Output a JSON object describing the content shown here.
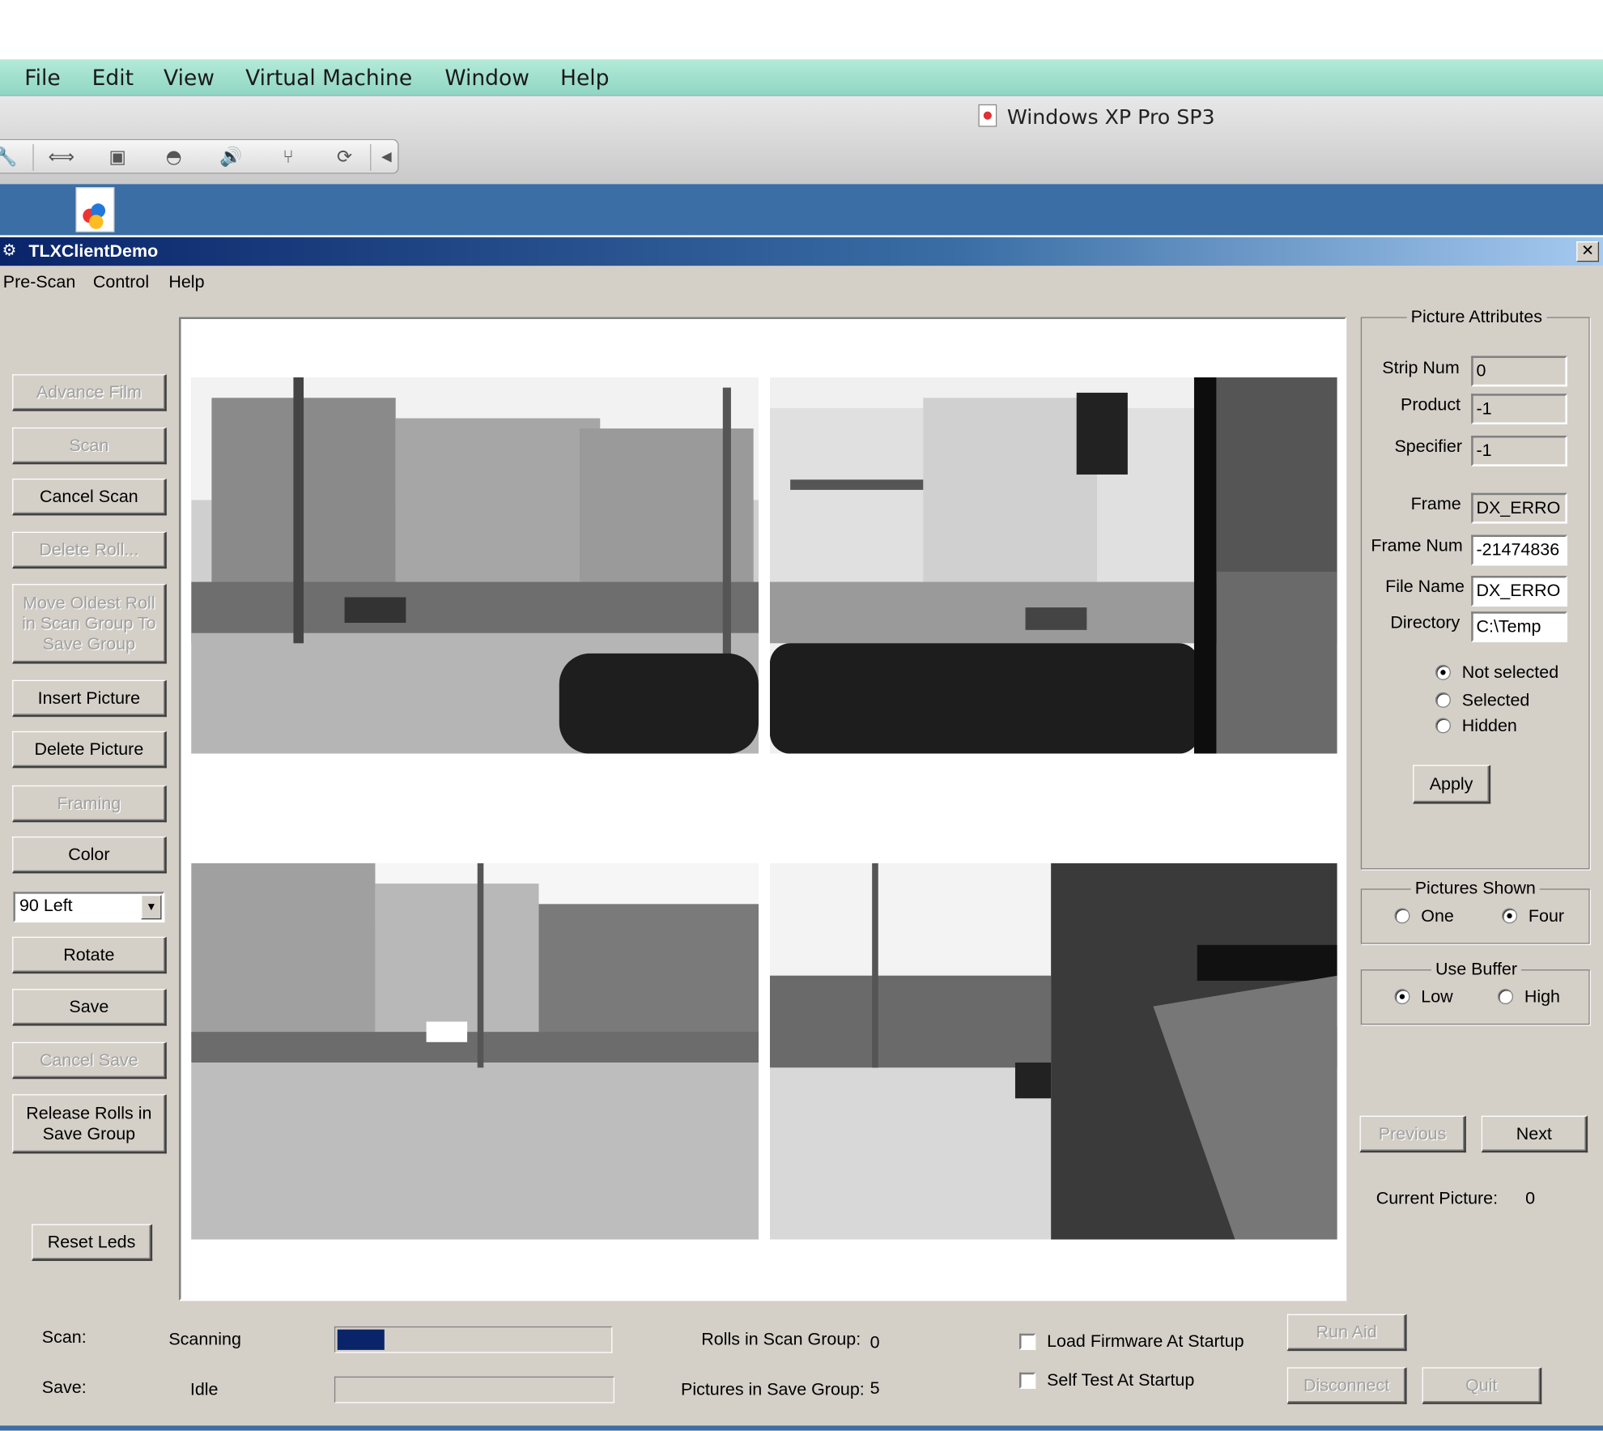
{
  "mac_menu": [
    "File",
    "Edit",
    "View",
    "Virtual Machine",
    "Window",
    "Help"
  ],
  "vm": {
    "title": "Windows XP Pro SP3"
  },
  "app": {
    "title": "TLXClientDemo",
    "close": "✕",
    "menu": [
      "Pre-Scan",
      "Control",
      "Help"
    ]
  },
  "left_buttons": {
    "advance_film": "Advance Film",
    "scan": "Scan",
    "cancel_scan": "Cancel Scan",
    "delete_roll": "Delete Roll...",
    "move_oldest": "Move Oldest Roll in Scan Group To Save Group",
    "insert_picture": "Insert Picture",
    "delete_picture": "Delete Picture",
    "framing": "Framing",
    "color": "Color",
    "rotation_value": "90 Left",
    "rotate": "Rotate",
    "save": "Save",
    "cancel_save": "Cancel Save",
    "release_rolls": "Release Rolls in Save Group",
    "reset_leds": "Reset Leds"
  },
  "picture_attributes": {
    "legend": "Picture Attributes",
    "strip_num_label": "Strip Num",
    "strip_num": "0",
    "product_label": "Product",
    "product": "-1",
    "specifier_label": "Specifier",
    "specifier": "-1",
    "frame_label": "Frame",
    "frame": "DX_ERRO",
    "frame_num_label": "Frame Num",
    "frame_num": "-21474836",
    "file_name_label": "File Name",
    "file_name": "DX_ERRO",
    "directory_label": "Directory",
    "directory": "C:\\Temp",
    "not_selected": "Not selected",
    "selected": "Selected",
    "hidden": "Hidden",
    "selection": "Not selected",
    "apply": "Apply"
  },
  "pictures_shown": {
    "legend": "Pictures Shown",
    "one": "One",
    "four": "Four",
    "value": "Four"
  },
  "use_buffer": {
    "legend": "Use Buffer",
    "low": "Low",
    "high": "High",
    "value": "Low"
  },
  "nav": {
    "previous": "Previous",
    "next": "Next",
    "current_label": "Current Picture:",
    "current_value": "0"
  },
  "status": {
    "scan_label": "Scan:",
    "scan_state": "Scanning",
    "scan_progress": 0.17,
    "save_label": "Save:",
    "save_state": "Idle",
    "save_progress": 0,
    "rolls_label": "Rolls in Scan Group:",
    "rolls_value": "0",
    "pictures_label": "Pictures in Save Group:",
    "pictures_value": "5",
    "load_firmware": "Load Firmware At Startup",
    "self_test": "Self Test At Startup",
    "run_aid": "Run Aid",
    "disconnect": "Disconnect",
    "quit": "Quit"
  },
  "colors": {
    "titlebar_start": "#0a246a",
    "window_bg": "#d4d0c8",
    "progress_fill": "#0a246a",
    "desktop": "#3a6ea5"
  }
}
